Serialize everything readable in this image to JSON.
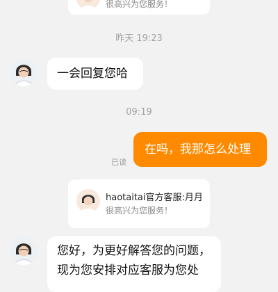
{
  "cards": [
    {
      "title": "",
      "subtitle": "很高兴为您服务！"
    },
    {
      "title": "haotaitai官方客服:月月",
      "subtitle": "很高兴为您服务！"
    }
  ],
  "timestamps": [
    "昨天 19:23",
    "09:19"
  ],
  "messages": {
    "agent_reply": "一会回复您哈",
    "user_msg": "在吗，我那怎么处理",
    "read_status": "已读",
    "agent_long_line1": "您好，为更好解答您的问题，",
    "agent_long_line2": "现为您安排对应客服为您处"
  },
  "colors": {
    "accent": "#ff8a00",
    "background": "#f2f2f2",
    "bubble": "#ffffff"
  }
}
